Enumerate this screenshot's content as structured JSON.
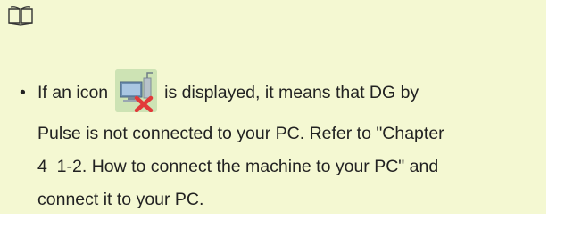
{
  "note": {
    "book_icon": "open-book-icon",
    "bullet": "•",
    "text_before_icon": "If an icon",
    "inline_icon": "pc-disconnected-icon",
    "text_after_icon": "is displayed, it means that DG by",
    "line2": "Pulse is not connected to your PC. Refer to \"Chapter",
    "line3": "4  1-2. How to connect the machine to your PC\" and",
    "line4": "connect it to your PC."
  },
  "colors": {
    "note_background": "#f4f8d2",
    "text": "#222222",
    "icon_cross": "#e23a3a",
    "icon_background": "#cde3b4"
  }
}
